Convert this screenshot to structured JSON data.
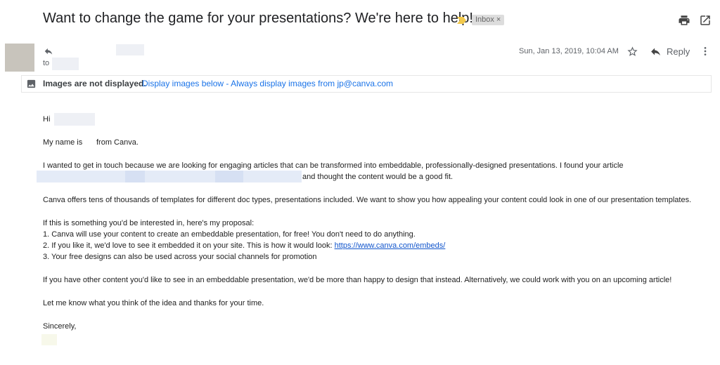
{
  "email": {
    "subject": "Want to change the game for your presentations? We're here to help!",
    "label": "Inbox",
    "label_remove": "×",
    "to_label": "to",
    "date": "Sun, Jan 13, 2019, 10:04 AM",
    "reply_label": "Reply"
  },
  "colors": {
    "accent_link": "#1a73e8",
    "importance_marker": "#f2c94c",
    "label_bg": "#dddddd"
  },
  "icons": {
    "importance": "importance-marker-icon",
    "print": "print-icon",
    "new_window": "open-in-new-window-icon",
    "reply_small": "reply-arrow-icon",
    "star": "star-icon",
    "reply": "reply-icon",
    "more": "more-vertical-icon",
    "image": "image-icon"
  },
  "images_banner": {
    "strong": "Images are not displayed.",
    "display_below": "Display images below",
    "separator": " - ",
    "always_display": "Always display images from jp@canva.com"
  },
  "body": {
    "greeting": "Hi",
    "intro_prefix": "My name is",
    "intro_suffix": "from Canva.",
    "para1_line1": "I wanted to get in touch because we are looking for engaging articles that can be transformed into embeddable, professionally-designed presentations. I found your article",
    "para1_line2_end": "and thought the content would be a good fit.",
    "para2": "Canva offers tens of thousands of templates for different doc types, presentations included. We want to show you how appealing your content could look in one of our presentation templates.",
    "proposal_intro": "If this is something you'd be interested in, here's my proposal:",
    "item1": "1. Canva will use your content to create an embeddable presentation, for free! You don't need to do anything.",
    "item2_prefix": "2. If you like it, we'd love to see it embedded it on your site. This is how it would look: ",
    "item2_link": "https://www.canva.com/embeds/",
    "item3": "3. Your free designs can also be used across your social channels for promotion",
    "para3": "If you have other content you'd like to see in an embeddable presentation, we'd be more than happy to design that instead. Alternatively, we could work with you on an upcoming article!",
    "para4": "Let me know what you think of the idea and thanks for your time.",
    "signoff": "Sincerely,"
  }
}
